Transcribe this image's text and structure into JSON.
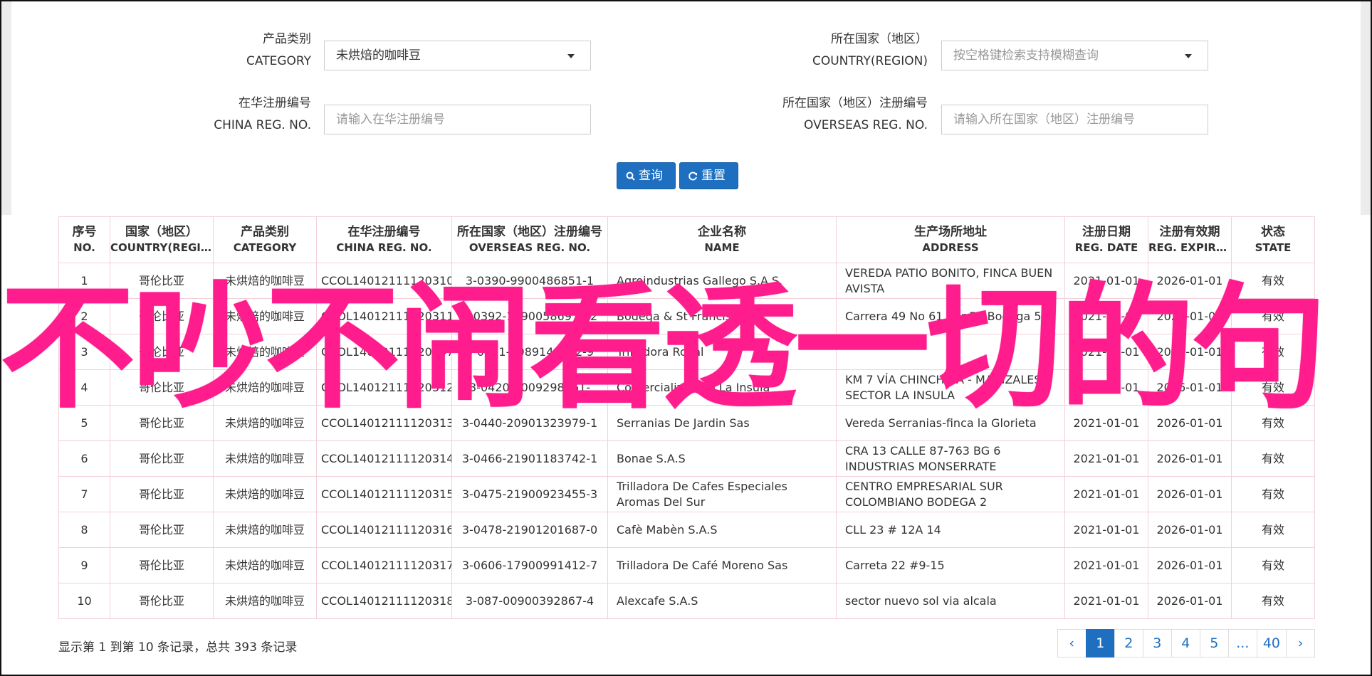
{
  "form": {
    "category": {
      "label_cn": "产品类别",
      "label_en": "CATEGORY",
      "value": "未烘焙的咖啡豆"
    },
    "country": {
      "label_cn": "所在国家（地区）",
      "label_en": "COUNTRY(REGION)",
      "placeholder": "按空格键检索支持模糊查询"
    },
    "china_reg": {
      "label_cn": "在华注册编号",
      "label_en": "CHINA REG. NO.",
      "placeholder": "请输入在华注册编号"
    },
    "overseas_reg": {
      "label_cn": "所在国家（地区）注册编号",
      "label_en": "OVERSEAS REG. NO.",
      "placeholder": "请输入所在国家（地区）注册编号"
    },
    "search_label": "查询",
    "reset_label": "重置"
  },
  "table": {
    "columns": [
      {
        "cn": "序号",
        "en": "NO."
      },
      {
        "cn": "国家（地区）",
        "en": "COUNTRY(REGIO..."
      },
      {
        "cn": "产品类别",
        "en": "CATEGORY"
      },
      {
        "cn": "在华注册编号",
        "en": "CHINA REG. NO."
      },
      {
        "cn": "所在国家（地区）注册编号",
        "en": "OVERSEAS REG. NO."
      },
      {
        "cn": "企业名称",
        "en": "NAME"
      },
      {
        "cn": "生产场所地址",
        "en": "ADDRESS"
      },
      {
        "cn": "注册日期",
        "en": "REG. DATE"
      },
      {
        "cn": "注册有效期",
        "en": "REG. EXPIRE ..."
      },
      {
        "cn": "状态",
        "en": "STATE"
      }
    ],
    "rows": [
      [
        "1",
        "哥伦比亚",
        "未烘焙的咖啡豆",
        "CCOL14012111120310",
        "3-0390-9900486851-1",
        "Agroindustrias Gallego S.A.S.",
        "VEREDA PATIO BONITO, FINCA BUEN AVISTA",
        "2021-01-01",
        "2026-01-01",
        "有效"
      ],
      [
        "2",
        "哥伦比亚",
        "未烘焙的咖啡豆",
        "CCOL14012111120311",
        "3-0392-19900586970-2",
        "Bodega & St Francis S.A.S.",
        "Carrera 49 No 61 Sur-54 Bodega 5",
        "2021-01-01",
        "2026-01-01",
        "有效"
      ],
      [
        "3",
        "哥伦比亚",
        "未烘焙的咖啡豆",
        "CCOL14012111120347",
        "3-0411-0089148312-9",
        "Trilladora Royal",
        "",
        "2021-01-01",
        "2026-01-01",
        "有效"
      ],
      [
        "4",
        "哥伦比亚",
        "未烘焙的咖啡豆",
        "CCOL14012111120312",
        "3-0420-9009298861-",
        "Comercializadero La Insula",
        "KM 7 VÍA CHINCHINA - MANIZALES, SECTOR LA INSULA",
        "2021-01-01",
        "2026-01-01",
        "有效"
      ],
      [
        "5",
        "哥伦比亚",
        "未烘焙的咖啡豆",
        "CCOL14012111120313",
        "3-0440-20901323979-1",
        "Serranias De Jardin Sas",
        "Vereda Serranias-finca la Glorieta",
        "2021-01-01",
        "2026-01-01",
        "有效"
      ],
      [
        "6",
        "哥伦比亚",
        "未烘焙的咖啡豆",
        "CCOL14012111120314",
        "3-0466-21901183742-1",
        "Bonae S.A.S",
        "CRA 13 CALLE 87-763 BG 6 INDUSTRIAS MONSERRATE",
        "2021-01-01",
        "2026-01-01",
        "有效"
      ],
      [
        "7",
        "哥伦比亚",
        "未烘焙的咖啡豆",
        "CCOL14012111120315",
        "3-0475-21900923455-3",
        "Trilladora De Cafes Especiales Aromas Del Sur",
        "CENTRO EMPRESARIAL SUR COLOMBIANO BODEGA 2",
        "2021-01-01",
        "2026-01-01",
        "有效"
      ],
      [
        "8",
        "哥伦比亚",
        "未烘焙的咖啡豆",
        "CCOL14012111120316",
        "3-0478-21901201687-0",
        "Cafè Mabèn S.A.S",
        "CLL 23 # 12A 14",
        "2021-01-01",
        "2026-01-01",
        "有效"
      ],
      [
        "9",
        "哥伦比亚",
        "未烘焙的咖啡豆",
        "CCOL14012111120317",
        "3-0606-17900991412-7",
        "Trilladora De Café Moreno Sas",
        "Carreta 22 #9-15",
        "2021-01-01",
        "2026-01-01",
        "有效"
      ],
      [
        "10",
        "哥伦比亚",
        "未烘焙的咖啡豆",
        "CCOL14012111120318",
        "3-087-00900392867-4",
        "Alexcafe S.A.S",
        "sector nuevo sol via alcala",
        "2021-01-01",
        "2026-01-01",
        "有效"
      ]
    ]
  },
  "footer": {
    "info": "显示第 1 到第 10 条记录，总共 393 条记录",
    "pages": [
      "‹",
      "1",
      "2",
      "3",
      "4",
      "5",
      "...",
      "40",
      "›"
    ],
    "active_page": "1"
  },
  "overlay_text": "不吵不闹看透一切的句",
  "colors": {
    "accent": "#1e6fc0",
    "overlay": "#ff1c8d",
    "border": "#f3d0d8"
  }
}
